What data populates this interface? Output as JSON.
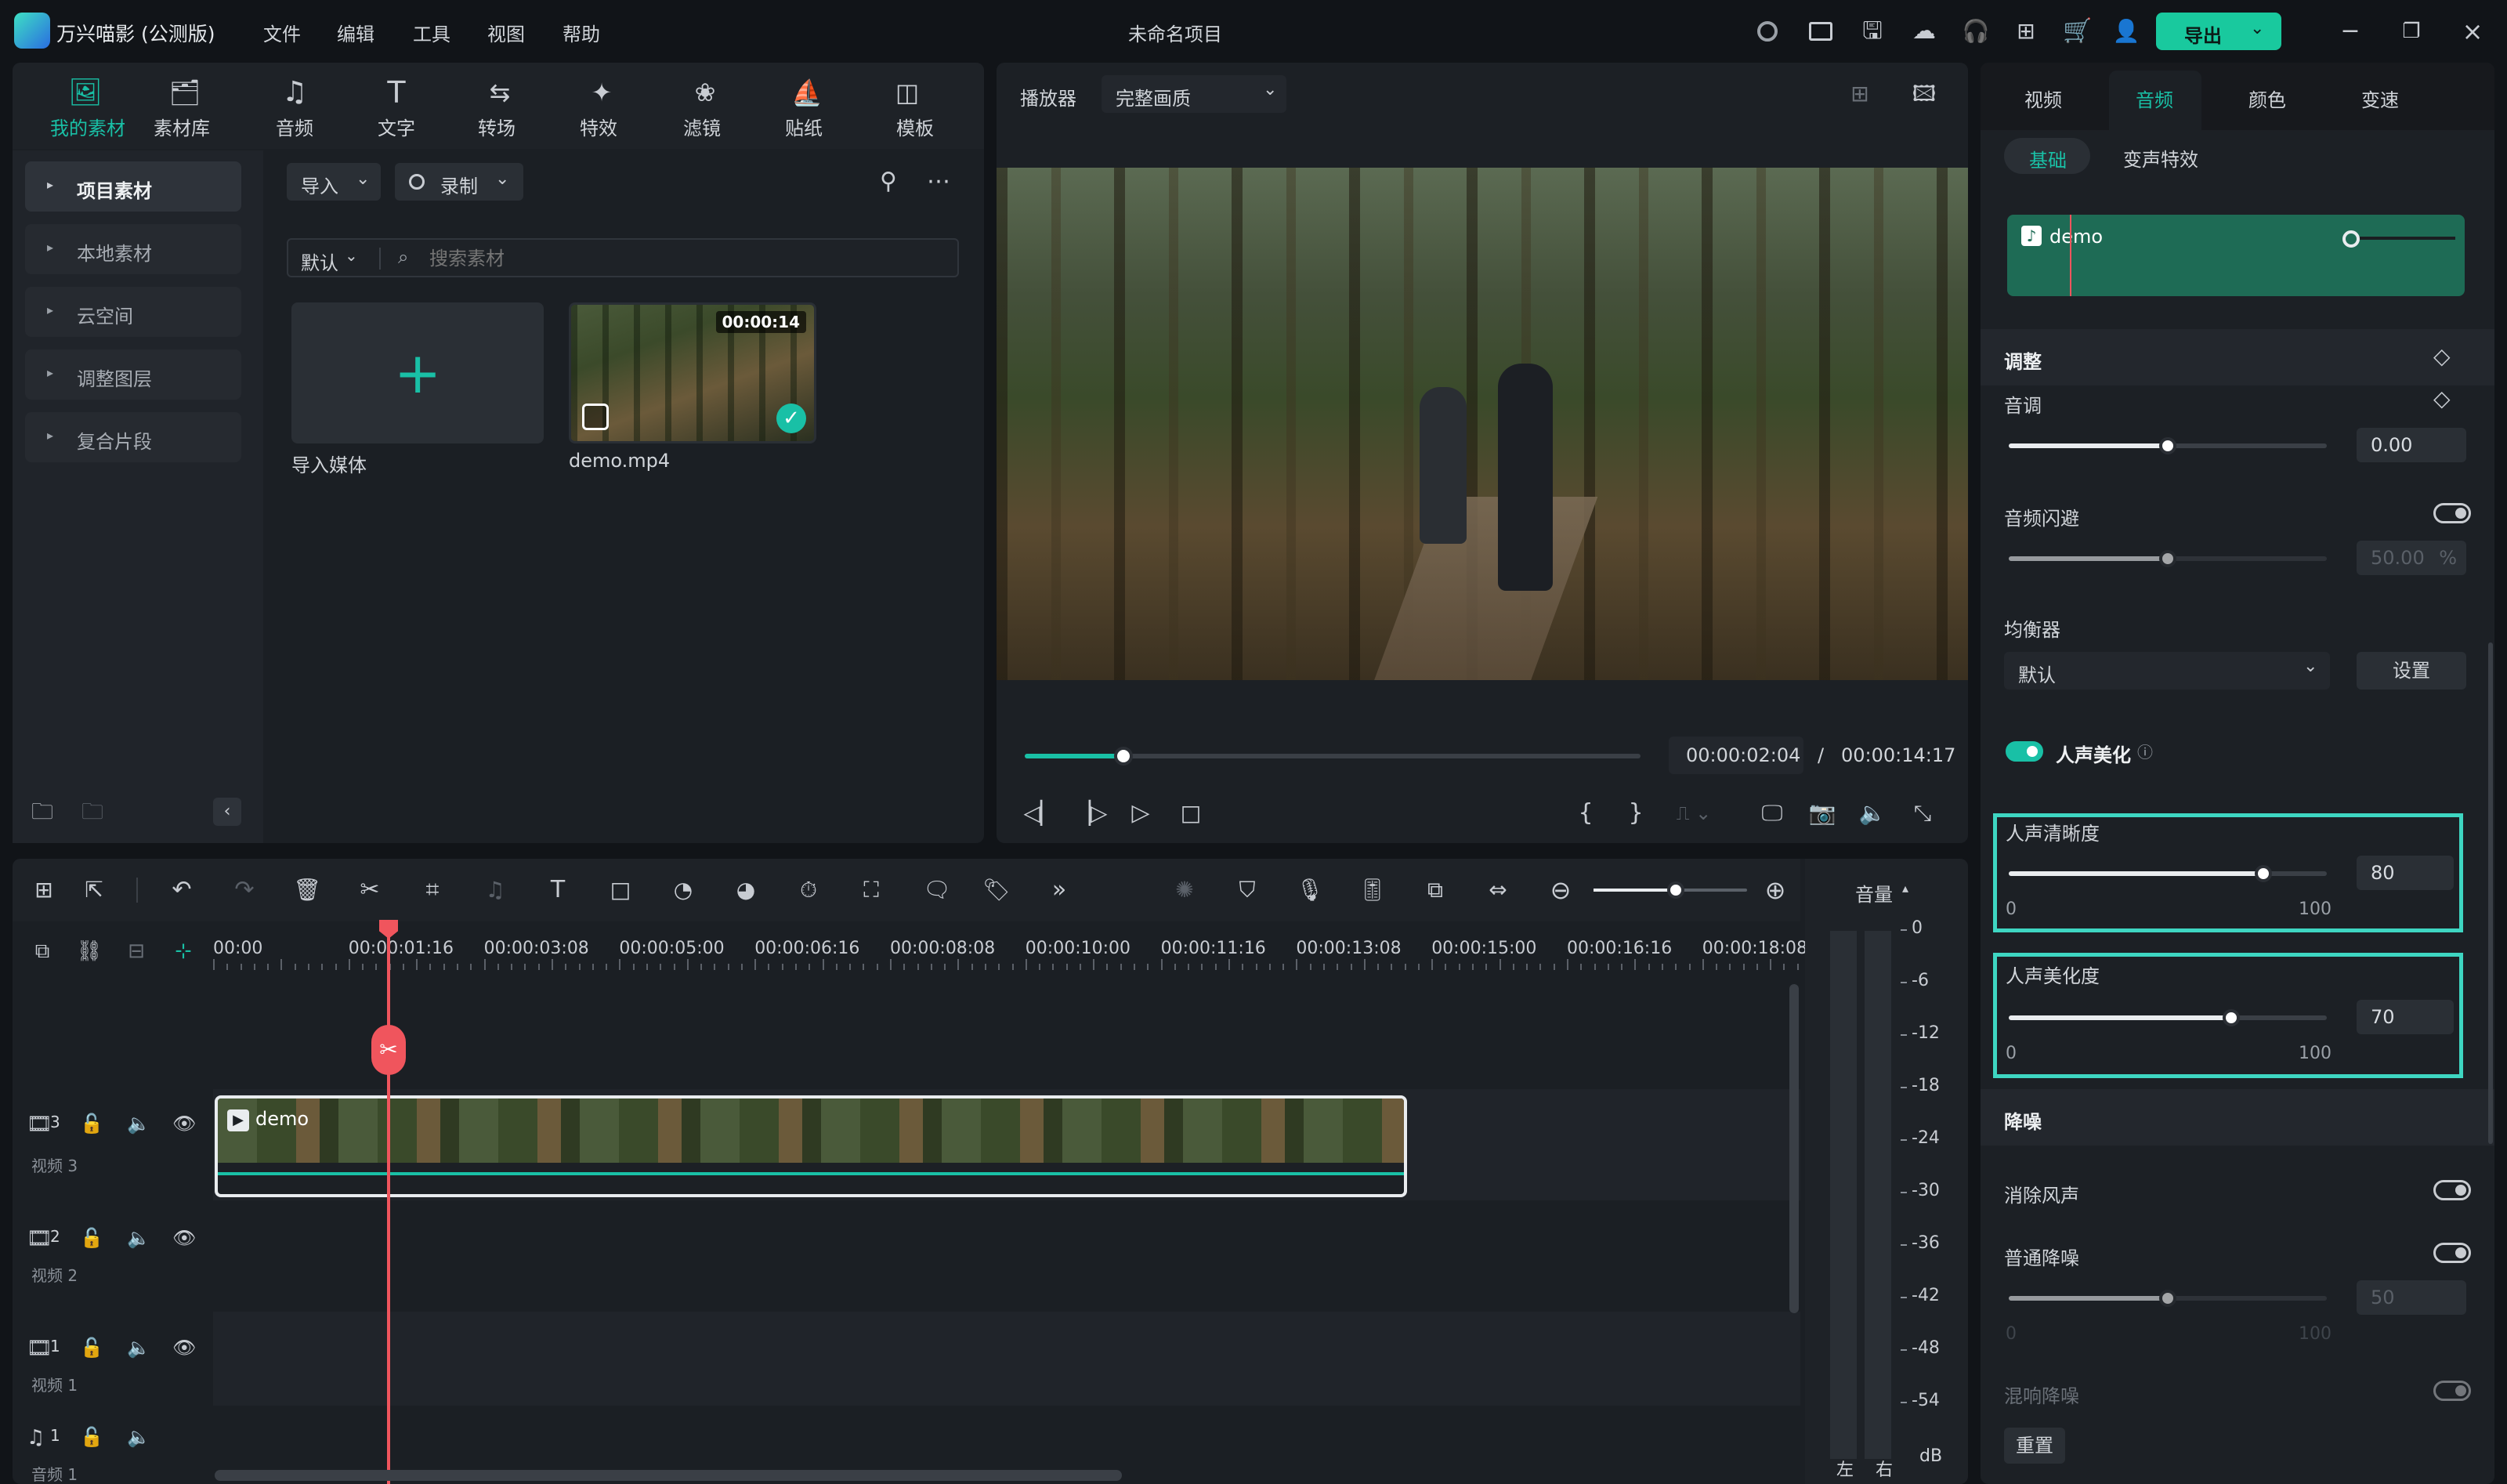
{
  "titlebar": {
    "app_name": "万兴喵影 (公测版)",
    "menus": [
      "文件",
      "编辑",
      "工具",
      "视图",
      "帮助"
    ],
    "project_title": "未命名项目",
    "export_label": "导出"
  },
  "media_tabs": [
    "我的素材",
    "素材库",
    "音频",
    "文字",
    "转场",
    "特效",
    "滤镜",
    "贴纸",
    "模板"
  ],
  "sidebar": {
    "items": [
      "项目素材",
      "本地素材",
      "云空间",
      "调整图层",
      "复合片段"
    ]
  },
  "media_toolbar": {
    "import_label": "导入",
    "record_label": "录制",
    "sort_label": "默认",
    "search_placeholder": "搜索素材"
  },
  "media_items": [
    {
      "label": "导入媒体"
    },
    {
      "label": "demo.mp4",
      "duration": "00:00:14"
    }
  ],
  "player": {
    "label": "播放器",
    "quality": "完整画质",
    "current_time": "00:00:02:04",
    "separator": "/",
    "total_time": "00:00:14:17",
    "progress": 0.16
  },
  "right_tabs": [
    "视频",
    "音频",
    "颜色",
    "变速"
  ],
  "right_subtabs": [
    "基础",
    "变声特效"
  ],
  "audio": {
    "clip_name": "demo",
    "adjust_header": "调整",
    "pitch_label": "音调",
    "pitch_value": "0.00",
    "pitch_level": 0.5,
    "ducking_label": "音频闪避",
    "ducking_value": "50.00",
    "ducking_unit": "%",
    "ducking_level": 0.5,
    "eq_label": "均衡器",
    "eq_value": "默认",
    "eq_settings": "设置",
    "voice_enhance_label": "人声美化",
    "clarity_label": "人声清晰度",
    "clarity_value": "80",
    "clarity_min": "0",
    "clarity_max": "100",
    "clarity_level": 0.8,
    "beautify_label": "人声美化度",
    "beautify_value": "70",
    "beautify_min": "0",
    "beautify_max": "100",
    "beautify_level": 0.7,
    "denoise_header": "降噪",
    "wind_label": "消除风声",
    "normal_label": "普通降噪",
    "normal_value": "50",
    "normal_min": "0",
    "normal_max": "100",
    "normal_level": 0.5,
    "reverb_label": "混响降噪",
    "reset_label": "重置"
  },
  "timeline": {
    "ruler": [
      "00:00",
      "00:00:01:16",
      "00:00:03:08",
      "00:00:05:00",
      "00:00:06:16",
      "00:00:08:08",
      "00:00:10:00",
      "00:00:11:16",
      "00:00:13:08",
      "00:00:15:00",
      "00:00:16:16",
      "00:00:18:08"
    ],
    "tracks": [
      {
        "num": "3",
        "name": "视频 3"
      },
      {
        "num": "2",
        "name": "视频 2"
      },
      {
        "num": "1",
        "name": "视频 1"
      },
      {
        "num": "1",
        "name": "音频 1"
      }
    ],
    "clip_label": "demo"
  },
  "meter": {
    "label": "音量",
    "scale": [
      "0",
      "-6",
      "-12",
      "-18",
      "-24",
      "-30",
      "-36",
      "-42",
      "-48",
      "-54"
    ],
    "unit": "dB",
    "left": "左",
    "right": "右"
  },
  "colors": {
    "accent": "#19c0a6",
    "playhead": "#f0555d",
    "export_bg": "#19c99e"
  }
}
